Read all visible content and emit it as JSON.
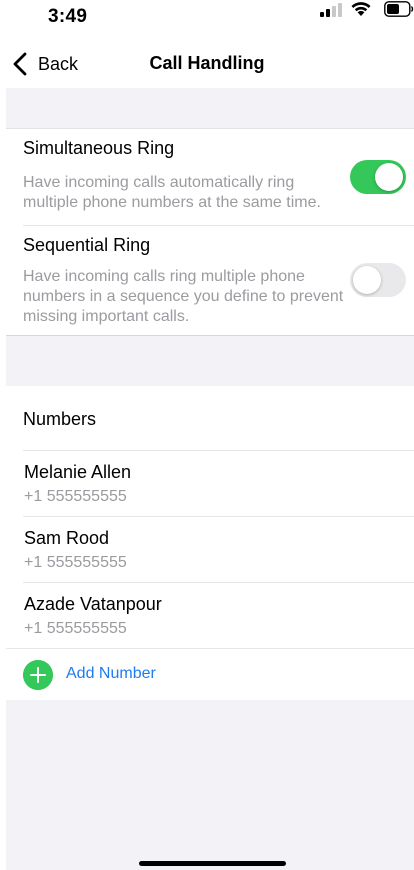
{
  "status_bar": {
    "time": "3:49",
    "icons": [
      "signal-icon",
      "wifi-icon",
      "battery-icon"
    ]
  },
  "nav": {
    "back_label": "Back",
    "title": "Call Handling",
    "back_icon": "chevron-left-icon"
  },
  "ring_options": [
    {
      "title": "Simultaneous Ring",
      "description": "Have incoming calls automatically ring multiple phone numbers at the same time.",
      "enabled": true
    },
    {
      "title": "Sequential Ring",
      "description": "Have incoming calls ring multiple phone numbers in a sequence you define to prevent missing important calls.",
      "enabled": false
    }
  ],
  "numbers": {
    "header": "Numbers",
    "items": [
      {
        "name": "Melanie Allen",
        "phone": "+1 555555555"
      },
      {
        "name": "Sam Rood",
        "phone": "+1 555555555"
      },
      {
        "name": "Azade Vatanpour",
        "phone": "+1 555555555"
      }
    ],
    "add_label": "Add Number",
    "add_icon": "plus-circle-icon"
  },
  "colors": {
    "toggle_on": "#34c759",
    "toggle_off": "#e9e9eb",
    "link": "#1d7cf2",
    "group_background": "#f2f2f7",
    "secondary_text": "#9b9ba0"
  }
}
